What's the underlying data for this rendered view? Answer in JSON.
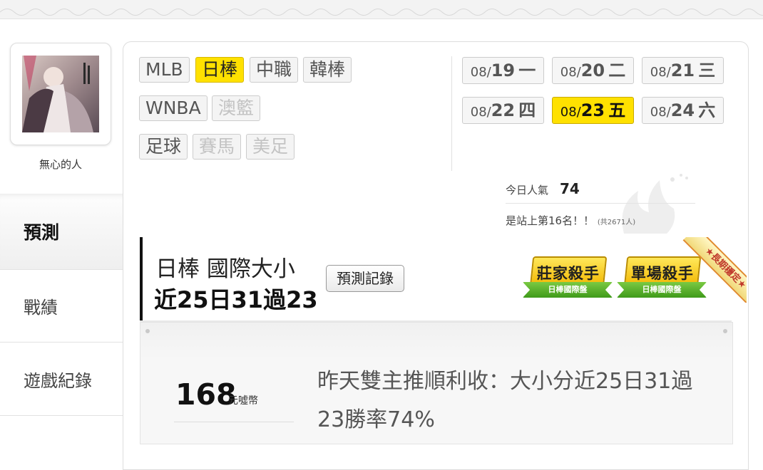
{
  "user": {
    "name": "無心的人"
  },
  "sidebar": {
    "tabs": [
      {
        "label": "預測",
        "active": true
      },
      {
        "label": "戰績"
      },
      {
        "label": "遊戲紀錄"
      }
    ]
  },
  "leagues": [
    {
      "label": "MLB",
      "state": "normal"
    },
    {
      "label": "日棒",
      "state": "selected"
    },
    {
      "label": "中職",
      "state": "normal"
    },
    {
      "label": "韓棒",
      "state": "normal"
    },
    {
      "label": "WNBA",
      "state": "normal"
    },
    {
      "label": "澳籃",
      "state": "disabled"
    },
    {
      "label": "足球",
      "state": "normal"
    },
    {
      "label": "賽馬",
      "state": "disabled"
    },
    {
      "label": "美足",
      "state": "disabled"
    }
  ],
  "dates": [
    {
      "month": "08/",
      "day": "19",
      "weekday": "一"
    },
    {
      "month": "08/",
      "day": "20",
      "weekday": "二"
    },
    {
      "month": "08/",
      "day": "21",
      "weekday": "三"
    },
    {
      "month": "08/",
      "day": "22",
      "weekday": "四"
    },
    {
      "month": "08/",
      "day": "23",
      "weekday": "五",
      "selected": true
    },
    {
      "month": "08/",
      "day": "24",
      "weekday": "六"
    }
  ],
  "popularity": {
    "label": "今日人氣",
    "value": "74",
    "rank_text": "是站上第16名！！",
    "total_text": "(共2671人)"
  },
  "prediction": {
    "title": "日棒 國際大小",
    "stat": "近25日31過23",
    "records_button": "預測記錄",
    "badges": [
      {
        "title": "莊家殺手",
        "subtitle": "日棒國際盤"
      },
      {
        "title": "單場殺手",
        "subtitle": "日棒國際盤"
      }
    ],
    "corner_ribbon": "★長期穩定★"
  },
  "content": {
    "coins": "168",
    "coins_unit": "元噓幣",
    "description": "昨天雙主推順利收：大小分近25日31過23勝率74%"
  },
  "colors": {
    "selected": "#ffe100",
    "accent_border": "#d6b800"
  }
}
